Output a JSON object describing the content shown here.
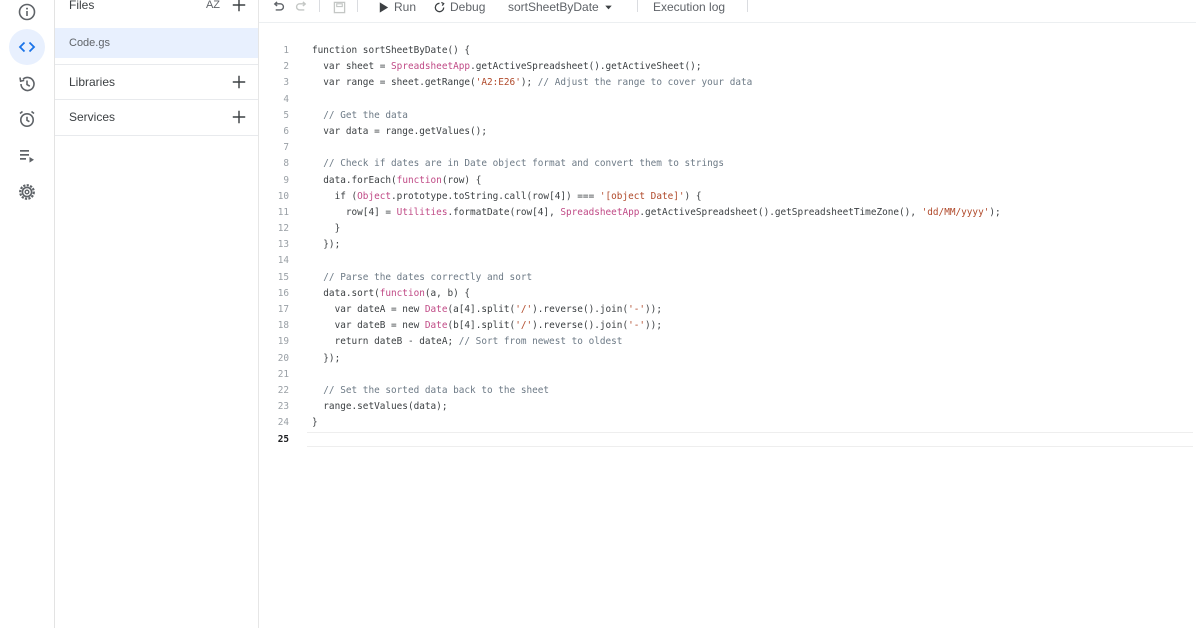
{
  "rail": {
    "items": [
      {
        "name": "overview-icon",
        "active": false
      },
      {
        "name": "editor-icon",
        "active": true
      },
      {
        "name": "history-icon",
        "active": false
      },
      {
        "name": "triggers-icon",
        "active": false
      },
      {
        "name": "executions-icon",
        "active": false
      },
      {
        "name": "settings-icon",
        "active": false
      }
    ]
  },
  "files_panel": {
    "files_header": "Files",
    "sort_label": "AZ",
    "files": [
      "Code.gs"
    ],
    "libraries_label": "Libraries",
    "services_label": "Services"
  },
  "toolbar": {
    "run_label": "Run",
    "debug_label": "Debug",
    "function_selector": "sortSheetByDate",
    "execution_log_label": "Execution log"
  },
  "editor": {
    "current_line": 25,
    "lines": [
      [
        [
          "t",
          "function sortSheetByDate() {"
        ]
      ],
      [
        [
          "t",
          "  var sheet = "
        ],
        [
          "c",
          "SpreadsheetApp"
        ],
        [
          "t",
          ".getActiveSpreadsheet().getActiveSheet();"
        ]
      ],
      [
        [
          "t",
          "  var range = sheet.getRange("
        ],
        [
          "s",
          "'A2:E26'"
        ],
        [
          "t",
          ");"
        ],
        [
          "m",
          " // Adjust the range to cover your data"
        ]
      ],
      [],
      [
        [
          "m",
          "  // Get the data"
        ]
      ],
      [
        [
          "t",
          "  var data = range.getValues();"
        ]
      ],
      [],
      [
        [
          "m",
          "  // Check if dates are in Date object format and convert them to strings"
        ]
      ],
      [
        [
          "t",
          "  data.forEach("
        ],
        [
          "c",
          "function"
        ],
        [
          "t",
          "(row) {"
        ]
      ],
      [
        [
          "t",
          "    if ("
        ],
        [
          "c",
          "Object"
        ],
        [
          "t",
          ".prototype.toString.call(row[4]) === "
        ],
        [
          "s",
          "'[object Date]'"
        ],
        [
          "t",
          ") {"
        ]
      ],
      [
        [
          "t",
          "      row[4] = "
        ],
        [
          "c",
          "Utilities"
        ],
        [
          "t",
          ".formatDate(row[4], "
        ],
        [
          "c",
          "SpreadsheetApp"
        ],
        [
          "t",
          ".getActiveSpreadsheet().getSpreadsheetTimeZone(), "
        ],
        [
          "s",
          "'dd/MM/yyyy'"
        ],
        [
          "t",
          ");"
        ]
      ],
      [
        [
          "t",
          "    }"
        ]
      ],
      [
        [
          "t",
          "  });"
        ]
      ],
      [],
      [
        [
          "m",
          "  // Parse the dates correctly and sort"
        ]
      ],
      [
        [
          "t",
          "  data.sort("
        ],
        [
          "c",
          "function"
        ],
        [
          "t",
          "(a, b) {"
        ]
      ],
      [
        [
          "t",
          "    var dateA = new "
        ],
        [
          "c",
          "Date"
        ],
        [
          "t",
          "(a[4].split("
        ],
        [
          "s",
          "'/'"
        ],
        [
          "t",
          ").reverse().join("
        ],
        [
          "s",
          "'-'"
        ],
        [
          "t",
          "));"
        ]
      ],
      [
        [
          "t",
          "    var dateB = new "
        ],
        [
          "c",
          "Date"
        ],
        [
          "t",
          "(b[4].split("
        ],
        [
          "s",
          "'/'"
        ],
        [
          "t",
          ").reverse().join("
        ],
        [
          "s",
          "'-'"
        ],
        [
          "t",
          "));"
        ]
      ],
      [
        [
          "t",
          "    return dateB - dateA;"
        ],
        [
          "m",
          " // Sort from newest to oldest"
        ]
      ],
      [
        [
          "t",
          "  });"
        ]
      ],
      [],
      [
        [
          "m",
          "  // Set the sorted data back to the sheet"
        ]
      ],
      [
        [
          "t",
          "  range.setValues(data);"
        ]
      ],
      [
        [
          "t",
          "}"
        ]
      ],
      []
    ]
  }
}
